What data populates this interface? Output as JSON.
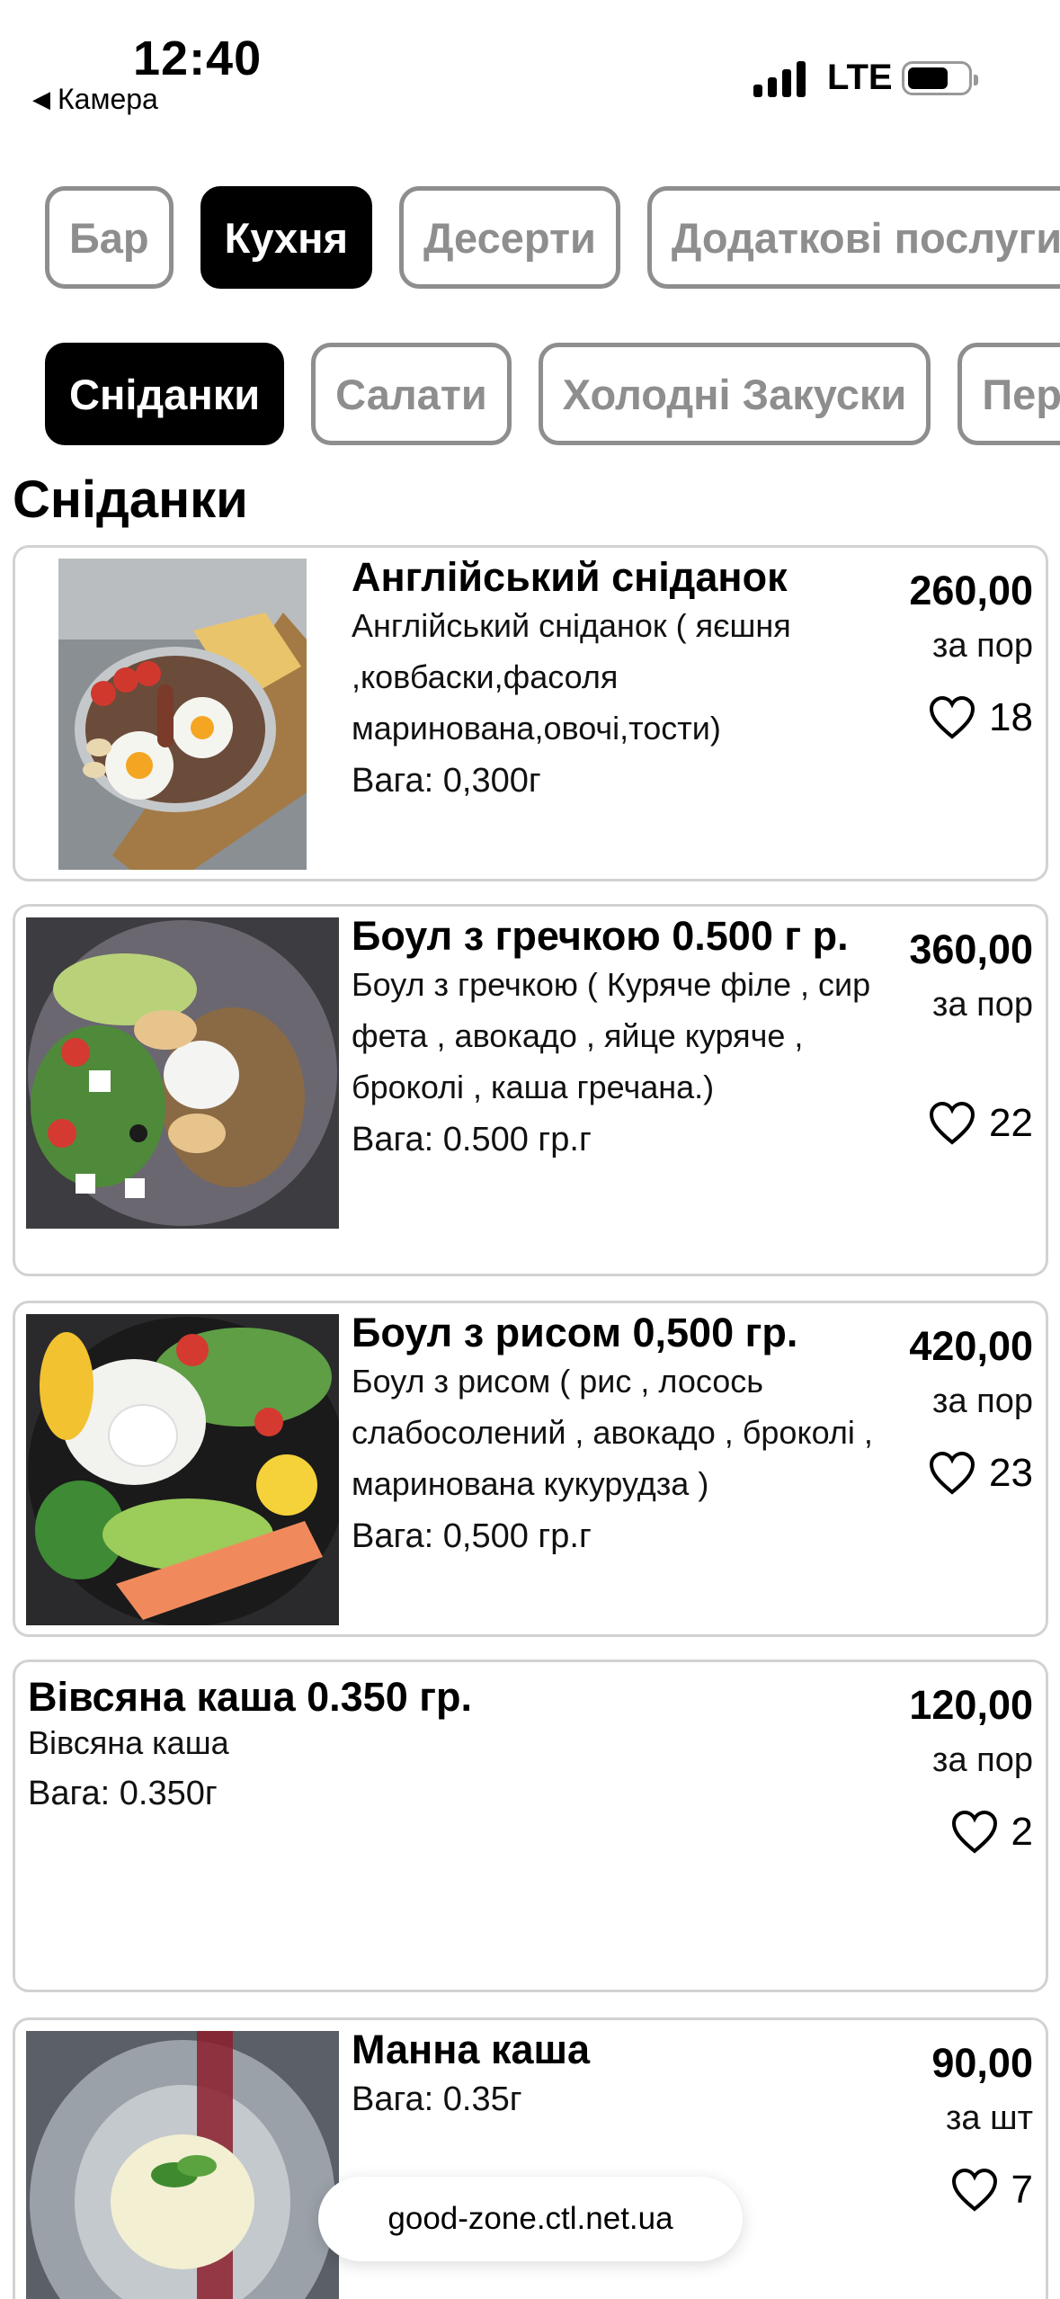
{
  "status_bar": {
    "time": "12:40",
    "back_label": "Камера",
    "network": "LTE"
  },
  "categories": [
    {
      "label": "Бар",
      "active": false
    },
    {
      "label": "Кухня",
      "active": true
    },
    {
      "label": "Десерти",
      "active": false
    },
    {
      "label": "Додаткові послуги",
      "active": false
    }
  ],
  "subcategories": [
    {
      "label": "Сніданки",
      "active": true
    },
    {
      "label": "Салати",
      "active": false
    },
    {
      "label": "Холодні Закуски",
      "active": false
    },
    {
      "label": "Пер",
      "active": false
    }
  ],
  "section_title": "Сніданки",
  "items": [
    {
      "name": "Англійський сніданок",
      "description": "Англійський сніданок ( яєшня ,ковбаски,фасоля маринована,овочі,тости)",
      "weight": "Вага: 0,300г",
      "price": "260,00",
      "unit": "за пор",
      "likes": "18",
      "image": "english-breakfast-photo"
    },
    {
      "name": "Боул з гречкою 0.500 г р.",
      "description": "Боул з гречкою ( Куряче філе , сир фета , авокадо , яйце куряче , броколі , каша гречана.)",
      "weight": "Вага: 0.500 гр.г",
      "price": "360,00",
      "unit": "за пор",
      "likes": "22",
      "image": "buckwheat-bowl-photo"
    },
    {
      "name": "Боул з рисом 0,500 гр.",
      "description": "Боул з рисом ( рис , лосось слабосолений , авокадо , броколі , маринована кукурудза )",
      "weight": "Вага: 0,500 гр.г",
      "price": "420,00",
      "unit": "за пор",
      "likes": "23",
      "image": "rice-bowl-photo"
    },
    {
      "name": "Вівсяна каша 0.350 гр.",
      "description": "Вівсяна каша",
      "weight": "Вага: 0.350г",
      "price": "120,00",
      "unit": "за пор",
      "likes": "2"
    },
    {
      "name": "Манна каша",
      "description": "",
      "weight": "Вага: 0.35г",
      "price": "90,00",
      "unit": "за шт",
      "likes": "7",
      "image": "semolina-porridge-photo"
    }
  ],
  "url_bar": {
    "domain": "good-zone.ctl.net.ua"
  },
  "icons": {
    "like": "heart-outline-icon",
    "back": "back-triangle-icon"
  }
}
